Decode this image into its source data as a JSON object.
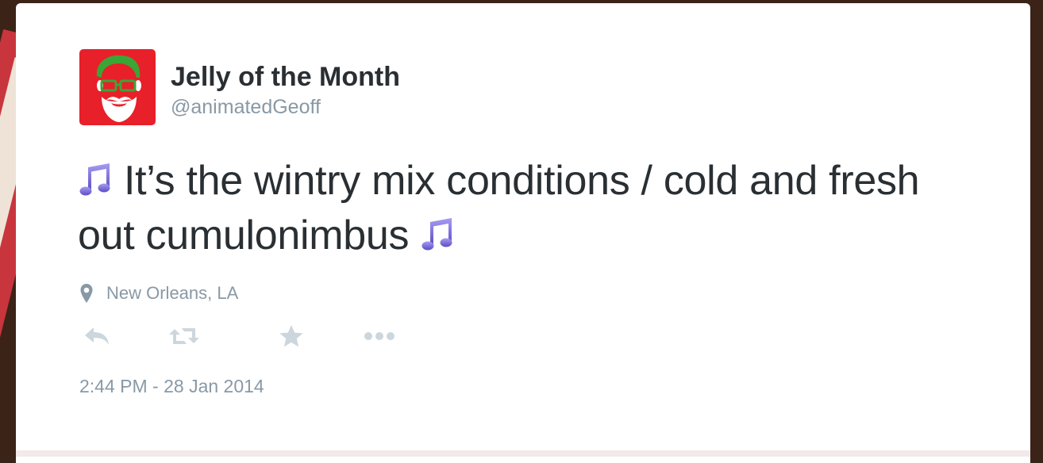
{
  "tweet": {
    "author": {
      "display_name": "Jelly of the Month",
      "handle": "@animatedGeoff"
    },
    "text": {
      "leading_icon": "musical-note-icon",
      "body": "It’s the wintry mix conditions / cold and fresh out cumulonimbus",
      "trailing_icon": "musical-note-icon"
    },
    "location": {
      "icon": "location-pin-icon",
      "label": "New Orleans, LA"
    },
    "actions": [
      {
        "name": "reply",
        "icon": "reply-icon"
      },
      {
        "name": "retweet",
        "icon": "retweet-icon"
      },
      {
        "name": "favorite",
        "icon": "star-icon"
      },
      {
        "name": "more",
        "icon": "more-dots-icon"
      }
    ],
    "timestamp": "2:44 PM - 28 Jan 2014"
  },
  "colors": {
    "primary_text": "#292f33",
    "secondary_text": "#8899a6",
    "action_icon": "#ccd6dd",
    "avatar_background": "#e8202a",
    "avatar_hair": "#3aa635",
    "note_purple": "#7b6fd8"
  }
}
